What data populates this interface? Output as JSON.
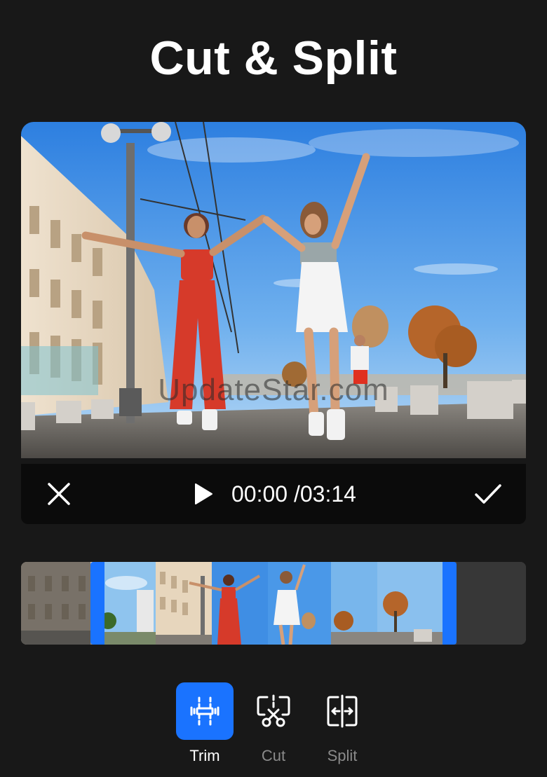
{
  "header": {
    "title": "Cut & Split"
  },
  "preview": {
    "watermark": "UpdateStar.com"
  },
  "controls": {
    "current_time": "00:00",
    "total_time": "/03:14",
    "close_icon": "close-icon",
    "play_icon": "play-icon",
    "confirm_icon": "check-icon"
  },
  "timeline": {
    "trim_start_fraction": 0.15,
    "trim_end_fraction": 0.86
  },
  "tools": [
    {
      "label": "Trim",
      "icon": "trim-icon",
      "active": true
    },
    {
      "label": "Cut",
      "icon": "cut-icon",
      "active": false
    },
    {
      "label": "Split",
      "icon": "split-icon",
      "active": false
    }
  ],
  "colors": {
    "accent": "#1a73ff",
    "background": "#181818",
    "bar": "#0b0b0b",
    "inactive_label": "#8a8a8a"
  }
}
